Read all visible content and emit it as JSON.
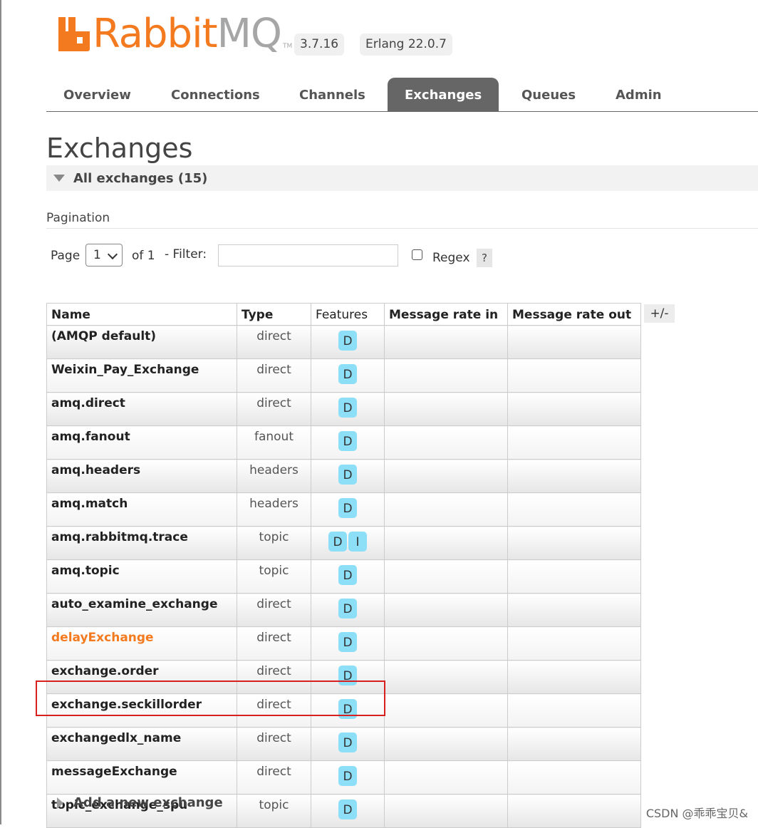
{
  "brand": {
    "name_orange": "Rabbit",
    "name_gray": "MQ",
    "tm": "TM"
  },
  "versions": {
    "rabbitmq": "3.7.16",
    "erlang": "Erlang 22.0.7"
  },
  "nav": {
    "tabs": [
      "Overview",
      "Connections",
      "Channels",
      "Exchanges",
      "Queues",
      "Admin"
    ],
    "active": "Exchanges"
  },
  "page": {
    "title": "Exchanges",
    "section": "All exchanges (15)"
  },
  "pagination": {
    "label": "Pagination",
    "page_label": "Page",
    "page_value": "1",
    "of_label": "of 1",
    "filter_label": "- Filter:",
    "filter_value": "",
    "regex_label": "Regex",
    "regex_checked": false,
    "help": "?"
  },
  "table": {
    "headers": [
      "Name",
      "Type",
      "Features",
      "Message rate in",
      "Message rate out"
    ],
    "toggle_columns": "+/-",
    "rows": [
      {
        "name": "(AMQP default)",
        "type": "direct",
        "features": [
          "D"
        ]
      },
      {
        "name": "Weixin_Pay_Exchange",
        "type": "direct",
        "features": [
          "D"
        ]
      },
      {
        "name": "amq.direct",
        "type": "direct",
        "features": [
          "D"
        ]
      },
      {
        "name": "amq.fanout",
        "type": "fanout",
        "features": [
          "D"
        ]
      },
      {
        "name": "amq.headers",
        "type": "headers",
        "features": [
          "D"
        ]
      },
      {
        "name": "amq.match",
        "type": "headers",
        "features": [
          "D"
        ]
      },
      {
        "name": "amq.rabbitmq.trace",
        "type": "topic",
        "features": [
          "D",
          "I"
        ]
      },
      {
        "name": "amq.topic",
        "type": "topic",
        "features": [
          "D"
        ]
      },
      {
        "name": "auto_examine_exchange",
        "type": "direct",
        "features": [
          "D"
        ]
      },
      {
        "name": "delayExchange",
        "type": "direct",
        "features": [
          "D"
        ],
        "highlight": true
      },
      {
        "name": "exchange.order",
        "type": "direct",
        "features": [
          "D"
        ]
      },
      {
        "name": "exchange.seckillorder",
        "type": "direct",
        "features": [
          "D"
        ]
      },
      {
        "name": "exchangedlx_name",
        "type": "direct",
        "features": [
          "D"
        ]
      },
      {
        "name": "messageExchange",
        "type": "direct",
        "features": [
          "D"
        ]
      },
      {
        "name": "topic_exchange_spu",
        "type": "topic",
        "features": [
          "D"
        ]
      }
    ]
  },
  "add_exchange": "Add a new exchange",
  "watermark": "CSDN @乖乖宝贝&",
  "colors": {
    "brand_orange": "#f47a20",
    "feature_badge": "#8ddff8",
    "annotation_red": "#d82020",
    "active_tab": "#666666"
  }
}
